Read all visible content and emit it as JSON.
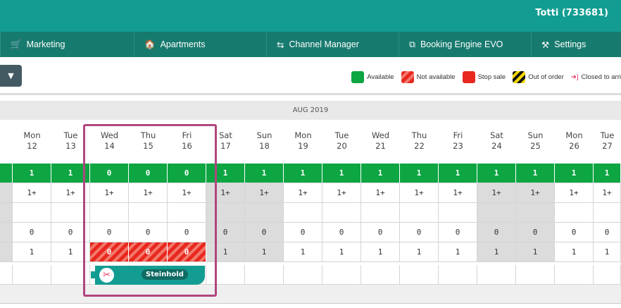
{
  "header": {
    "user": "Totti (733681)"
  },
  "nav": [
    {
      "label": "Marketing",
      "icon": "🛒",
      "name": "cart-icon"
    },
    {
      "label": "Apartments",
      "icon": "🏠",
      "name": "home-icon"
    },
    {
      "label": "Channel Manager",
      "icon": "⇆",
      "name": "swap-icon"
    },
    {
      "label": "Booking Engine EVO",
      "icon": "⧉",
      "name": "booking-engine-icon"
    },
    {
      "label": "Settings",
      "icon": "⚒",
      "name": "tools-icon"
    }
  ],
  "legend": {
    "available": "Available",
    "not_available": "Not available",
    "stop_sale": "Stop sale",
    "out_of_order": "Out of order",
    "closed_to_arrival": "Closed to arri"
  },
  "month": "AUG 2019",
  "colors": {
    "available": "#0ea543",
    "stop": "#e8281f",
    "accent": "#139d92",
    "selection": "#b0467e"
  },
  "days": [
    {
      "dow": "Mon",
      "d": "12",
      "avail": "1",
      "r2": "1+",
      "r4": "0",
      "r5": "1"
    },
    {
      "dow": "Tue",
      "d": "13",
      "avail": "1",
      "r2": "1+",
      "r4": "0",
      "r5": "1"
    },
    {
      "dow": "Wed",
      "d": "14",
      "avail": "0",
      "r2": "1+",
      "r4": "0",
      "r5": "0",
      "na": true
    },
    {
      "dow": "Thu",
      "d": "15",
      "avail": "0",
      "r2": "1+",
      "r4": "0",
      "r5": "0",
      "na": true
    },
    {
      "dow": "Fri",
      "d": "16",
      "avail": "0",
      "r2": "1+",
      "r4": "0",
      "r5": "0",
      "na": true
    },
    {
      "dow": "Sat",
      "d": "17",
      "avail": "1",
      "r2": "1+",
      "r4": "0",
      "r5": "1",
      "we": true
    },
    {
      "dow": "Sun",
      "d": "18",
      "avail": "1",
      "r2": "1+",
      "r4": "0",
      "r5": "1",
      "we": true
    },
    {
      "dow": "Mon",
      "d": "19",
      "avail": "1",
      "r2": "1+",
      "r4": "0",
      "r5": "1"
    },
    {
      "dow": "Tue",
      "d": "20",
      "avail": "1",
      "r2": "1+",
      "r4": "0",
      "r5": "1"
    },
    {
      "dow": "Wed",
      "d": "21",
      "avail": "1",
      "r2": "1+",
      "r4": "0",
      "r5": "1"
    },
    {
      "dow": "Thu",
      "d": "22",
      "avail": "1",
      "r2": "1+",
      "r4": "0",
      "r5": "1"
    },
    {
      "dow": "Fri",
      "d": "23",
      "avail": "1",
      "r2": "1+",
      "r4": "0",
      "r5": "1"
    },
    {
      "dow": "Sat",
      "d": "24",
      "avail": "1",
      "r2": "1+",
      "r4": "0",
      "r5": "1",
      "we": true
    },
    {
      "dow": "Sun",
      "d": "25",
      "avail": "1",
      "r2": "1+",
      "r4": "0",
      "r5": "1",
      "we": true
    },
    {
      "dow": "Mon",
      "d": "26",
      "avail": "1",
      "r2": "1+",
      "r4": "0",
      "r5": "1"
    },
    {
      "dow": "Tue",
      "d": "27",
      "avail": "1",
      "r2": "1+",
      "r4": "0",
      "r5": "1"
    }
  ],
  "booking": {
    "guest": "Steinhold"
  }
}
